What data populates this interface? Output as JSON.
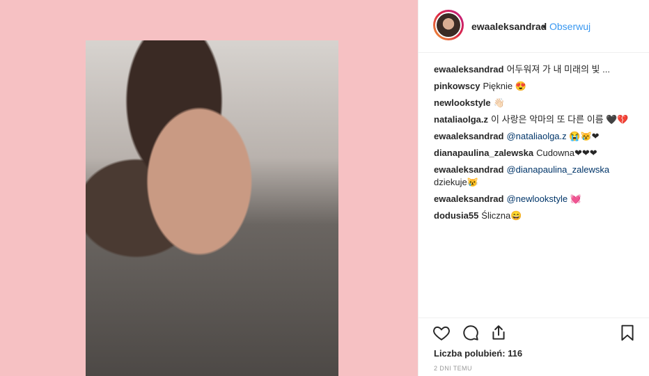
{
  "post": {
    "username": "ewaaleksandrad",
    "dot": "•",
    "follow_label": "Obserwuj"
  },
  "comments": [
    {
      "user": "ewaaleksandrad",
      "text": "어두워져 가 내 미래의 빛 ..."
    },
    {
      "user": "pinkowscy",
      "text": "Pięknie 😍"
    },
    {
      "user": "newlookstyle",
      "text": "👋🏻"
    },
    {
      "user": "nataliaolga.z",
      "text": "이 사랑은 악마의 또 다른 이름 🖤💔"
    },
    {
      "user": "ewaaleksandrad",
      "mention": "@nataliaolga.z",
      "text": "😭😿❤"
    },
    {
      "user": "dianapaulina_zalewska",
      "text": "Cudowna❤❤❤"
    },
    {
      "user": "ewaaleksandrad",
      "mention": "@dianapaulina_zalewska",
      "text": "dziekuje😿"
    },
    {
      "user": "ewaaleksandrad",
      "mention": "@newlookstyle",
      "text": "💓"
    },
    {
      "user": "dodusia55",
      "text": "Śliczna😄"
    }
  ],
  "footer": {
    "likes": "Liczba polubień: 116",
    "time": "2 DNI TEMU"
  },
  "icons": {
    "like": "heart-icon",
    "comment": "comment-icon",
    "share": "share-icon",
    "save": "bookmark-icon"
  },
  "colors": {
    "background_pink": "#f6c1c3",
    "link_blue": "#3897f0",
    "mention_blue": "#003569"
  }
}
